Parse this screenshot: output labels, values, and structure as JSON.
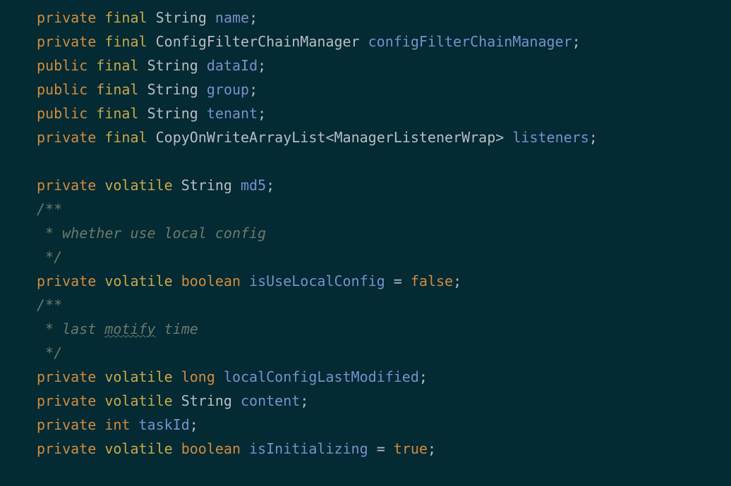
{
  "code": {
    "lines": [
      {
        "tokens": [
          {
            "cls": "kw-orange",
            "t": "private"
          },
          {
            "cls": null,
            "t": " "
          },
          {
            "cls": "kw-yellow",
            "t": "final"
          },
          {
            "cls": null,
            "t": " "
          },
          {
            "cls": "type",
            "t": "String"
          },
          {
            "cls": null,
            "t": " "
          },
          {
            "cls": "identifier",
            "t": "name"
          },
          {
            "cls": "punct",
            "t": ";"
          }
        ]
      },
      {
        "tokens": [
          {
            "cls": "kw-orange",
            "t": "private"
          },
          {
            "cls": null,
            "t": " "
          },
          {
            "cls": "kw-yellow",
            "t": "final"
          },
          {
            "cls": null,
            "t": " "
          },
          {
            "cls": "type",
            "t": "ConfigFilterChainManager"
          },
          {
            "cls": null,
            "t": " "
          },
          {
            "cls": "identifier",
            "t": "configFilterChainManager"
          },
          {
            "cls": "punct",
            "t": ";"
          }
        ]
      },
      {
        "tokens": [
          {
            "cls": "kw-orange",
            "t": "public"
          },
          {
            "cls": null,
            "t": " "
          },
          {
            "cls": "kw-yellow",
            "t": "final"
          },
          {
            "cls": null,
            "t": " "
          },
          {
            "cls": "type",
            "t": "String"
          },
          {
            "cls": null,
            "t": " "
          },
          {
            "cls": "identifier",
            "t": "dataId"
          },
          {
            "cls": "punct",
            "t": ";"
          }
        ]
      },
      {
        "tokens": [
          {
            "cls": "kw-orange",
            "t": "public"
          },
          {
            "cls": null,
            "t": " "
          },
          {
            "cls": "kw-yellow",
            "t": "final"
          },
          {
            "cls": null,
            "t": " "
          },
          {
            "cls": "type",
            "t": "String"
          },
          {
            "cls": null,
            "t": " "
          },
          {
            "cls": "identifier",
            "t": "group"
          },
          {
            "cls": "punct",
            "t": ";"
          }
        ]
      },
      {
        "tokens": [
          {
            "cls": "kw-orange",
            "t": "public"
          },
          {
            "cls": null,
            "t": " "
          },
          {
            "cls": "kw-yellow",
            "t": "final"
          },
          {
            "cls": null,
            "t": " "
          },
          {
            "cls": "type",
            "t": "String"
          },
          {
            "cls": null,
            "t": " "
          },
          {
            "cls": "identifier",
            "t": "tenant"
          },
          {
            "cls": "punct",
            "t": ";"
          }
        ]
      },
      {
        "tokens": [
          {
            "cls": "kw-orange",
            "t": "private"
          },
          {
            "cls": null,
            "t": " "
          },
          {
            "cls": "kw-yellow",
            "t": "final"
          },
          {
            "cls": null,
            "t": " "
          },
          {
            "cls": "type",
            "t": "CopyOnWriteArrayList"
          },
          {
            "cls": "punct",
            "t": "<"
          },
          {
            "cls": "type",
            "t": "ManagerListenerWrap"
          },
          {
            "cls": "punct",
            "t": ">"
          },
          {
            "cls": null,
            "t": " "
          },
          {
            "cls": "identifier",
            "t": "listeners"
          },
          {
            "cls": "punct",
            "t": ";"
          }
        ]
      },
      {
        "tokens": []
      },
      {
        "tokens": [
          {
            "cls": "kw-orange",
            "t": "private"
          },
          {
            "cls": null,
            "t": " "
          },
          {
            "cls": "kw-yellow",
            "t": "volatile"
          },
          {
            "cls": null,
            "t": " "
          },
          {
            "cls": "type",
            "t": "String"
          },
          {
            "cls": null,
            "t": " "
          },
          {
            "cls": "identifier",
            "t": "md5"
          },
          {
            "cls": "punct",
            "t": ";"
          }
        ]
      },
      {
        "tokens": [
          {
            "cls": "comment",
            "t": "/**"
          }
        ]
      },
      {
        "tokens": [
          {
            "cls": "comment",
            "t": " * whether use local config"
          }
        ]
      },
      {
        "tokens": [
          {
            "cls": "comment",
            "t": " */"
          }
        ]
      },
      {
        "tokens": [
          {
            "cls": "kw-orange",
            "t": "private"
          },
          {
            "cls": null,
            "t": " "
          },
          {
            "cls": "kw-yellow",
            "t": "volatile"
          },
          {
            "cls": null,
            "t": " "
          },
          {
            "cls": "kw-orange",
            "t": "boolean"
          },
          {
            "cls": null,
            "t": " "
          },
          {
            "cls": "identifier",
            "t": "isUseLocalConfig"
          },
          {
            "cls": null,
            "t": " "
          },
          {
            "cls": "op",
            "t": "="
          },
          {
            "cls": null,
            "t": " "
          },
          {
            "cls": "kw-orange",
            "t": "false"
          },
          {
            "cls": "punct",
            "t": ";"
          }
        ]
      },
      {
        "tokens": [
          {
            "cls": "comment",
            "t": "/**"
          }
        ]
      },
      {
        "tokens": [
          {
            "cls": "comment",
            "t": " * last "
          },
          {
            "cls": "comment underline",
            "t": "motify"
          },
          {
            "cls": "comment",
            "t": " time"
          }
        ]
      },
      {
        "tokens": [
          {
            "cls": "comment",
            "t": " */"
          }
        ]
      },
      {
        "tokens": [
          {
            "cls": "kw-orange",
            "t": "private"
          },
          {
            "cls": null,
            "t": " "
          },
          {
            "cls": "kw-yellow",
            "t": "volatile"
          },
          {
            "cls": null,
            "t": " "
          },
          {
            "cls": "kw-orange",
            "t": "long"
          },
          {
            "cls": null,
            "t": " "
          },
          {
            "cls": "identifier",
            "t": "localConfigLastModified"
          },
          {
            "cls": "punct",
            "t": ";"
          }
        ]
      },
      {
        "tokens": [
          {
            "cls": "kw-orange",
            "t": "private"
          },
          {
            "cls": null,
            "t": " "
          },
          {
            "cls": "kw-yellow",
            "t": "volatile"
          },
          {
            "cls": null,
            "t": " "
          },
          {
            "cls": "type",
            "t": "String"
          },
          {
            "cls": null,
            "t": " "
          },
          {
            "cls": "identifier",
            "t": "content"
          },
          {
            "cls": "punct",
            "t": ";"
          }
        ]
      },
      {
        "tokens": [
          {
            "cls": "kw-orange",
            "t": "private"
          },
          {
            "cls": null,
            "t": " "
          },
          {
            "cls": "kw-orange",
            "t": "int"
          },
          {
            "cls": null,
            "t": " "
          },
          {
            "cls": "identifier",
            "t": "taskId"
          },
          {
            "cls": "punct",
            "t": ";"
          }
        ]
      },
      {
        "tokens": [
          {
            "cls": "kw-orange",
            "t": "private"
          },
          {
            "cls": null,
            "t": " "
          },
          {
            "cls": "kw-yellow",
            "t": "volatile"
          },
          {
            "cls": null,
            "t": " "
          },
          {
            "cls": "kw-orange",
            "t": "boolean"
          },
          {
            "cls": null,
            "t": " "
          },
          {
            "cls": "identifier",
            "t": "isInitializing"
          },
          {
            "cls": null,
            "t": " "
          },
          {
            "cls": "op",
            "t": "="
          },
          {
            "cls": null,
            "t": " "
          },
          {
            "cls": "kw-orange",
            "t": "true"
          },
          {
            "cls": "punct",
            "t": ";"
          }
        ]
      }
    ]
  }
}
